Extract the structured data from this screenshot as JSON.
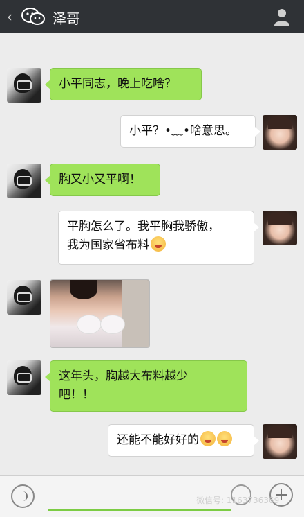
{
  "header": {
    "back": "‹",
    "title": "泽哥"
  },
  "messages": [
    {
      "side": "left",
      "text": "小平同志，晚上吃啥？"
    },
    {
      "side": "right",
      "text": "小平？•﹏•啥意思。"
    },
    {
      "side": "left",
      "text": "胸又小又平啊！"
    },
    {
      "side": "right",
      "line1": "平胸怎么了。我平胸我骄傲，",
      "line2": "我为国家省布料"
    },
    {
      "side": "left",
      "image": "photo"
    },
    {
      "side": "left",
      "line1": "这年头，胸越大布料越少",
      "line2": "吧！！"
    },
    {
      "side": "right",
      "text": "还能不能好好的"
    }
  ],
  "bottom": {
    "watermark": "微信号: 1163736369"
  }
}
